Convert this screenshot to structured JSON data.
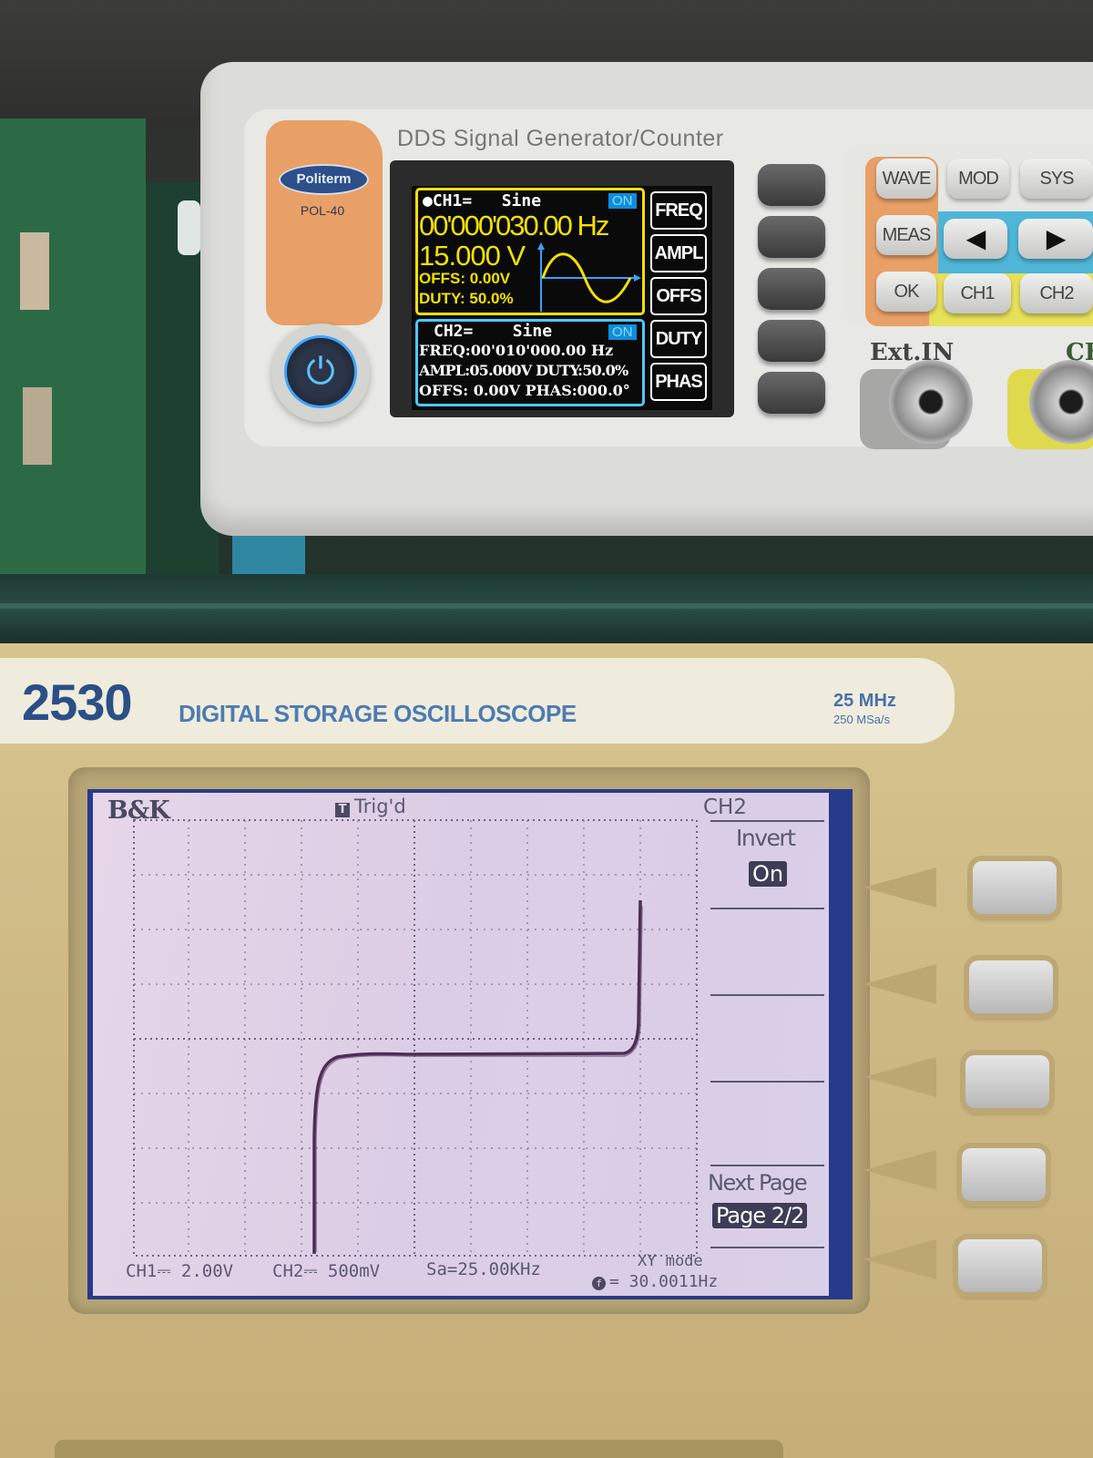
{
  "generator": {
    "brand": "Politerm",
    "model": "POL-40",
    "title": "DDS Signal Generator/Counter",
    "ch1": {
      "header": "●CH1=",
      "wave": "Sine",
      "status": "ON",
      "freq": "00'000'030.00 Hz",
      "ampl": "15.000 V",
      "offs": "OFFS:  0.00V",
      "duty": "DUTY:  50.0%"
    },
    "ch2": {
      "header": "CH2=",
      "wave": "Sine",
      "status": "ON",
      "line1": "FREQ:00'010'000.00 Hz",
      "line2": "AMPL:05.000V DUTY:50.0%",
      "line3": "OFFS:  0.00V PHAS:000.0°"
    },
    "softkeys": [
      "FREQ",
      "AMPL",
      "OFFS",
      "DUTY",
      "PHAS"
    ],
    "keypad": {
      "row1": [
        "WAVE",
        "MOD",
        "SYS"
      ],
      "row2_left": "MEAS",
      "row3": [
        "OK",
        "CH1",
        "CH2"
      ]
    },
    "ext_in": "Ext.IN",
    "ch_partial": "CH",
    "colors": {
      "ch1": "#f3e100",
      "ch2": "#4fc7ff",
      "accent_orange": "#e8a066"
    }
  },
  "oscilloscope": {
    "model": "2530",
    "title": "DIGITAL STORAGE OSCILLOSCOPE",
    "bandwidth": "25 MHz",
    "sample_rate": "250 MSa/s",
    "screen": {
      "brand": "B&K",
      "trigger": "Trig'd",
      "trigger_icon": "T",
      "channel": "CH2",
      "menu": {
        "invert_label": "Invert",
        "invert_value": "On",
        "next_label": "Next Page",
        "page_value": "Page 2/2"
      },
      "status": {
        "ch1": "CH1⎓ 2.00V",
        "ch2": "CH2⎓ 500mV",
        "sa": "Sa=25.00KHz",
        "mode": "XY mode",
        "freq_icon": "f",
        "freq": "= 30.0011Hz"
      }
    }
  }
}
